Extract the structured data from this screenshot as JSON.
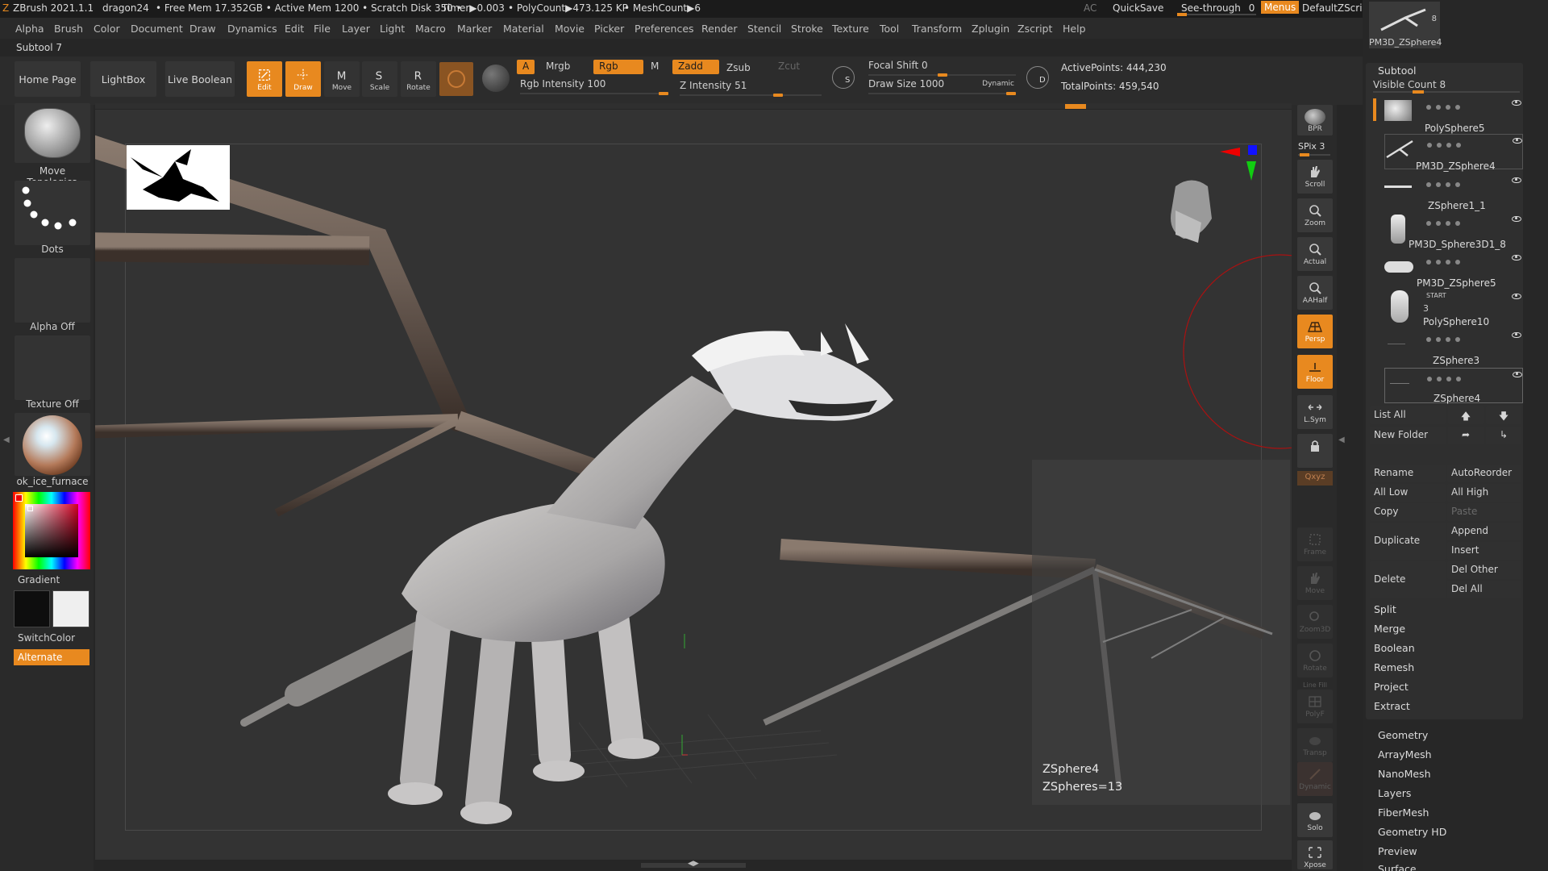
{
  "titlebar": {
    "app": "ZBrush 2021.1.1",
    "doc": "dragon24",
    "free_mem": "• Free Mem 17.352GB • Active Mem 1200 • Scratch Disk 350 •",
    "timer": "Timer▶0.003",
    "polycount": "• PolyCount▶473.125 KP",
    "meshcount": "• MeshCount▶6",
    "ac": "AC",
    "quicksave": "QuickSave",
    "see_through": "See-through",
    "see_through_value": "0",
    "menus": "Menus",
    "script": "DefaultZScript"
  },
  "menubar": [
    "Alpha",
    "Brush",
    "Color",
    "Document",
    "Draw",
    "Dynamics",
    "Edit",
    "File",
    "Layer",
    "Light",
    "Macro",
    "Marker",
    "Material",
    "Movie",
    "Picker",
    "Preferences",
    "Render",
    "Stencil",
    "Stroke",
    "Texture",
    "Tool",
    "Transform",
    "Zplugin",
    "Zscript",
    "Help"
  ],
  "subtool_title": "Subtool 7",
  "shelf": {
    "home": "Home Page",
    "lightbox": "LightBox",
    "liveboolean": "Live Boolean",
    "tools": [
      {
        "label": "Edit",
        "on": true
      },
      {
        "label": "Draw",
        "on": true
      },
      {
        "label": "Move",
        "on": false
      },
      {
        "label": "Scale",
        "on": false
      },
      {
        "label": "Rotate",
        "on": false
      }
    ],
    "a": "A",
    "mrgb": "Mrgb",
    "rgb": "Rgb",
    "m": "M",
    "zadd": "Zadd",
    "zsub": "Zsub",
    "zcut": "Zcut",
    "rgb_intensity": "Rgb Intensity 100",
    "rgb_intensity_value": 100,
    "z_intensity": "Z Intensity 51",
    "z_intensity_value": 51,
    "focal_shift": "Focal Shift 0",
    "focal_shift_value": 0,
    "draw_size": "Draw Size 1000",
    "draw_size_value": 1000,
    "dynamic": "Dynamic",
    "s": "S",
    "d": "D",
    "active_points": "ActivePoints: 444,230",
    "total_points": "TotalPoints: 459,540"
  },
  "left": {
    "brush": "Move Topologica",
    "stroke": "Dots",
    "alpha": "Alpha Off",
    "texture": "Texture Off",
    "material": "ok_ice_furnace",
    "gradient": "Gradient",
    "switchcolor": "SwitchColor",
    "alternate": "Alternate"
  },
  "rightbar": {
    "bpr": "BPR",
    "spix": "SPix 3",
    "buttons": [
      {
        "label": "Scroll",
        "state": "normal"
      },
      {
        "label": "Zoom",
        "state": "normal"
      },
      {
        "label": "Actual",
        "state": "normal"
      },
      {
        "label": "AAHalf",
        "state": "normal"
      },
      {
        "label": "Persp",
        "state": "on"
      },
      {
        "label": "Floor",
        "state": "on"
      },
      {
        "label": "L.Sym",
        "state": "normal"
      },
      {
        "label": "",
        "state": "normal"
      },
      {
        "label": "Frame",
        "state": "dim"
      },
      {
        "label": "Move",
        "state": "dim"
      },
      {
        "label": "Zoom3D",
        "state": "dim"
      },
      {
        "label": "Rotate",
        "state": "dim"
      },
      {
        "label": "PolyF",
        "state": "dim"
      },
      {
        "label": "Transp",
        "state": "dim"
      },
      {
        "label": "Dynamic",
        "state": "dim"
      },
      {
        "label": "Solo",
        "state": "normal"
      },
      {
        "label": "Xpose",
        "state": "normal"
      }
    ],
    "line_fill": "Line Fill",
    "xyz": "Qxyz"
  },
  "panel": {
    "top_thumb_label": "PM3D_ZSphere4",
    "top_thumb_count": "8",
    "subtool": "Subtool",
    "visible_count": "Visible Count 8",
    "subtools": [
      {
        "name": "PolySphere5",
        "selected": false
      },
      {
        "name": "PM3D_ZSphere4",
        "selected": true
      },
      {
        "name": "ZSphere1_1",
        "selected": false
      },
      {
        "name": "PM3D_Sphere3D1_8",
        "selected": false
      },
      {
        "name": "PM3D_ZSphere5",
        "selected": false
      },
      {
        "name": "PolySphere10",
        "selected": false
      },
      {
        "name": "ZSphere3",
        "selected": false
      },
      {
        "name": "ZSphere4",
        "selected": true
      }
    ],
    "start_label": "START",
    "start_num": "3",
    "list_all": "List All",
    "new_folder": "New Folder",
    "rename": "Rename",
    "autoreorder": "AutoReorder",
    "all_low": "All Low",
    "all_high": "All High",
    "copy": "Copy",
    "paste": "Paste",
    "duplicate": "Duplicate",
    "append": "Append",
    "insert": "Insert",
    "delete": "Delete",
    "del_other": "Del Other",
    "del_all": "Del All",
    "split": "Split",
    "merge": "Merge",
    "boolean": "Boolean",
    "remesh": "Remesh",
    "project": "Project",
    "extract": "Extract",
    "sections": [
      "Geometry",
      "ArrayMesh",
      "NanoMesh",
      "Layers",
      "FiberMesh",
      "Geometry HD",
      "Preview",
      "Surface"
    ]
  },
  "tooltip": {
    "name": "ZSphere4",
    "count": "ZSpheres=13"
  },
  "colors": {
    "accent": "#e8891f",
    "main_color": "#111111",
    "secondary_color": "#f0f0f0"
  }
}
